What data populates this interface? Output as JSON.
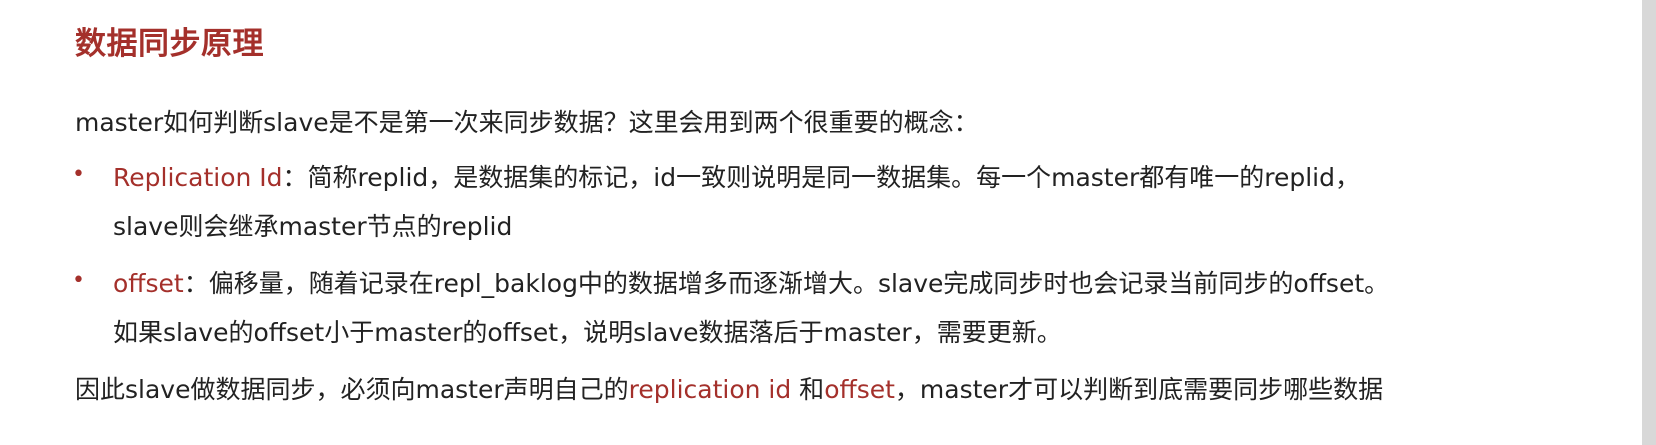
{
  "title": "数据同步原理",
  "intro": "master如何判断slave是不是第一次来同步数据？这里会用到两个很重要的概念：",
  "items": [
    {
      "term": "Replication Id",
      "line1": "：简称replid，是数据集的标记，id一致则说明是同一数据集。每一个master都有唯一的replid，",
      "line2": "slave则会继承master节点的replid"
    },
    {
      "term": "offset",
      "line1": "：偏移量，随着记录在repl_baklog中的数据增多而逐渐增大。slave完成同步时也会记录当前同步的offset。",
      "line2": "如果slave的offset小于master的offset，说明slave数据落后于master，需要更新。"
    }
  ],
  "conclusion": {
    "part1": "因此slave做数据同步，必须向master声明自己的",
    "term1": "replication id",
    "part2": " 和",
    "term2": "offset",
    "part3": "，master才可以判断到底需要同步哪些数据"
  },
  "colors": {
    "accent": "#a4302b",
    "text": "#222222"
  }
}
